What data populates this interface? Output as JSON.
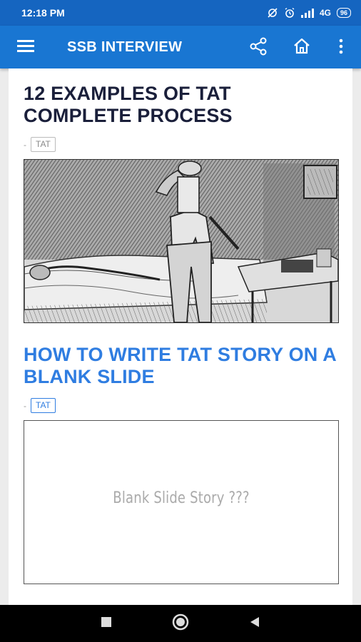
{
  "status_bar": {
    "time": "12:18 PM",
    "network": "4G",
    "battery": "96",
    "icons": [
      "sync-off-icon",
      "alarm-icon",
      "signal-icon",
      "network-label",
      "battery-icon"
    ]
  },
  "app_bar": {
    "title": "SSB INTERVIEW",
    "icons": [
      "menu-icon",
      "share-icon",
      "home-icon",
      "more-vert-icon"
    ]
  },
  "posts": [
    {
      "title": "12 EXAMPLES OF TAT COMPLETE PROCESS",
      "meta_separator": "-",
      "tag": "TAT",
      "thumbnail": "sketch-image"
    },
    {
      "title": "HOW TO WRITE TAT STORY ON A BLANK SLIDE",
      "meta_separator": "-",
      "tag": "TAT",
      "thumbnail_caption": "Blank Slide Story ???"
    }
  ],
  "nav_bar": {
    "icons": [
      "recents-square-icon",
      "home-circle-icon",
      "back-triangle-icon"
    ]
  },
  "colors": {
    "status_bar": "#1565c0",
    "app_bar": "#1976d2",
    "post_title_dark": "#1a1f3a",
    "post_title_blue": "#2f7de1",
    "page_background": "#ececec"
  }
}
